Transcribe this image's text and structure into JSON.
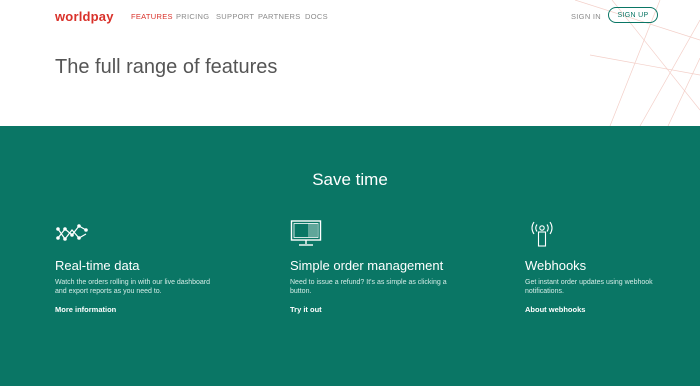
{
  "header": {
    "logo": "worldpay",
    "nav": [
      "FEATURES",
      "PRICING",
      "SUPPORT",
      "PARTNERS",
      "DOCS"
    ],
    "active_nav": "FEATURES",
    "sign_in": "SIGN IN",
    "sign_up": "SIGN UP"
  },
  "hero": {
    "title": "The full range of features"
  },
  "features": {
    "section_title": "Save time",
    "items": [
      {
        "icon": "chart-nodes-icon",
        "title": "Real-time data",
        "description": "Watch the orders rolling in with our live dashboard and export reports as you need to.",
        "link": "More information"
      },
      {
        "icon": "monitor-icon",
        "title": "Simple order management",
        "description": "Need to issue a refund? It's as simple as clicking a button.",
        "link": "Try it out"
      },
      {
        "icon": "broadcast-icon",
        "title": "Webhooks",
        "description": "Get instant order updates using webhook notifications.",
        "link": "About webhooks"
      }
    ]
  },
  "colors": {
    "brand_red": "#d9312a",
    "brand_green": "#0a7665"
  }
}
